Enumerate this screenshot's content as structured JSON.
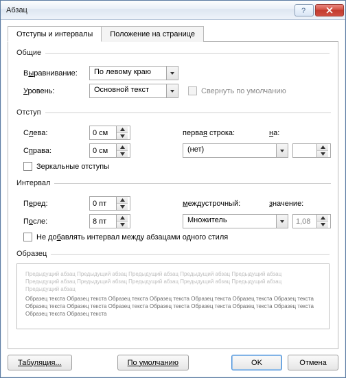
{
  "title": "Абзац",
  "tabs": {
    "indent": "Отступы и интервалы",
    "position": "Положение на странице"
  },
  "general": {
    "legend": "Общие",
    "alignment_label_pre": "В",
    "alignment_label_u": "ы",
    "alignment_label_post": "равнивание:",
    "alignment_value": "По левому краю",
    "level_label_pre": "",
    "level_label_u": "У",
    "level_label_post": "ровень:",
    "level_value": "Основной текст",
    "collapse_label": "Свернуть по умолчанию"
  },
  "indent": {
    "legend": "Отступ",
    "left_label_pre": "С",
    "left_label_u": "л",
    "left_label_post": "ева:",
    "left_value": "0 см",
    "right_label_pre": "С",
    "right_label_u": "п",
    "right_label_post": "рава:",
    "right_value": "0 см",
    "firstline_label": "перва",
    "firstline_u": "я",
    "firstline_post": " строка:",
    "firstline_value": "(нет)",
    "by_label_u": "н",
    "by_label_post": "а:",
    "by_value": "",
    "mirror_label": "Зеркальные отступы"
  },
  "spacing": {
    "legend": "Интервал",
    "before_label_pre": "П",
    "before_label_u": "е",
    "before_label_post": "ред:",
    "before_value": "0 пт",
    "after_label_pre": "П",
    "after_label_u": "о",
    "after_label_post": "сле:",
    "after_value": "8 пт",
    "linespc_label_u": "м",
    "linespc_label_post": "еждустрочный:",
    "linespc_value": "Множитель",
    "at_label_u": "з",
    "at_label_post": "начение:",
    "at_value": "1,08",
    "nosame_label_pre": "Не до",
    "nosame_label_u": "б",
    "nosame_label_post": "авлять интервал между абзацами одного стиля"
  },
  "sample": {
    "legend": "Образец",
    "prev1": "Предыдущий абзац Предыдущий абзац Предыдущий абзац Предыдущий абзац Предыдущий абзац",
    "prev2": "Предыдущий абзац Предыдущий абзац Предыдущий абзац Предыдущий абзац Предыдущий абзац",
    "prev3": "Предыдущий абзац",
    "body1": "Образец текста Образец текста Образец текста Образец текста Образец текста Образец текста Образец текста",
    "body2": "Образец текста Образец текста Образец текста Образец текста Образец текста Образец текста Образец текста",
    "body3": "Образец текста Образец текста"
  },
  "buttons": {
    "tabs": "Табуляция...",
    "default": "По умолчанию",
    "ok": "OK",
    "cancel": "Отмена"
  }
}
